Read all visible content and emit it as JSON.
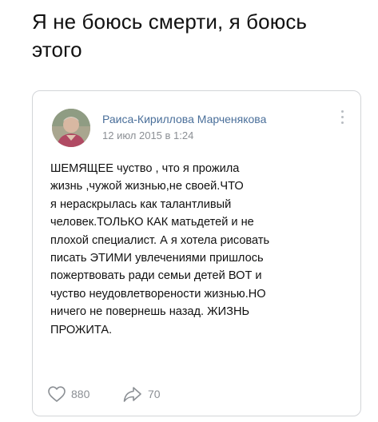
{
  "headline": {
    "line1": "Я не боюсь смерти, я боюсь",
    "line2": "этого"
  },
  "post": {
    "author": "Раиса-Кириллова Марченякова",
    "date": "12 июл 2015 в 1:24",
    "text_lines": [
      "ШЕМЯЩЕЕ чуство , что я прожила",
      "жизнь ,чужой жизнью,не своей.ЧТО",
      "я нераскрылась  как талантливый",
      "человек.ТОЛЬКО КАК матьдетей  и не",
      "плохой специалист. А я хотела рисовать",
      "писать ЭТИМИ  увлечениями пришлось",
      "пожертвовать ради  семьи детей ВОТ и",
      "чуство  неудовлетворености жизнью.НО",
      "ничего не повернешь назад. ЖИЗНЬ",
      "ПРОЖИТА."
    ],
    "likes_count": "880",
    "shares_count": "70"
  },
  "icons": {
    "like": "heart-icon",
    "share": "share-arrow-icon",
    "more": "more-dots-icon"
  },
  "colors": {
    "author_link": "#4a6f9a",
    "muted": "#8b8f94",
    "border": "#d3d5d8"
  }
}
